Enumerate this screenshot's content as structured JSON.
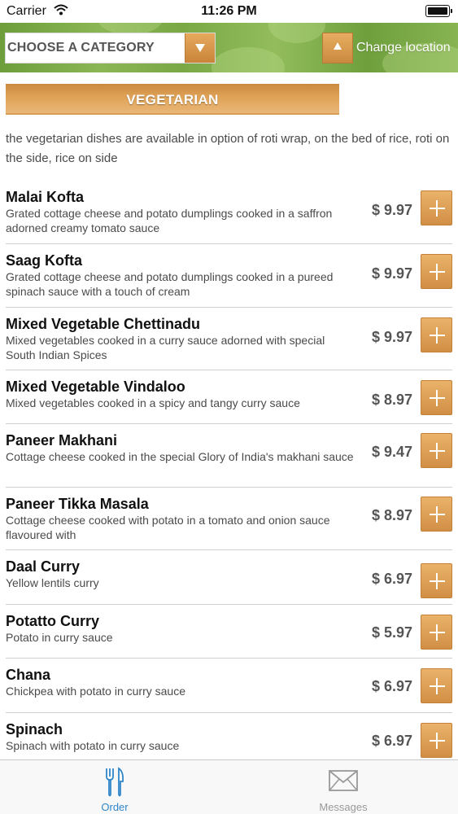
{
  "status_bar": {
    "carrier": "Carrier",
    "time": "11:26 PM"
  },
  "header": {
    "category_placeholder": "CHOOSE A CATEGORY",
    "location_label": "Change location"
  },
  "section": {
    "title": "VEGETARIAN",
    "description": "the vegetarian dishes are available in option of roti wrap, on the bed of rice, roti on the side, rice on side"
  },
  "menu_items": [
    {
      "name": "Malai Kofta",
      "description": "Grated cottage cheese and potato dumplings cooked in a saffron adorned creamy tomato sauce",
      "price": "$ 9.97"
    },
    {
      "name": "Saag Kofta",
      "description": "Grated cottage cheese and potato dumplings cooked in a pureed spinach sauce with a touch of cream",
      "price": "$ 9.97"
    },
    {
      "name": "Mixed Vegetable Chettinadu",
      "description": "Mixed vegetables cooked in a curry sauce adorned with special South Indian Spices",
      "price": "$ 9.97"
    },
    {
      "name": "Mixed Vegetable Vindaloo",
      "description": "Mixed vegetables cooked in a spicy and tangy curry sauce",
      "price": "$ 8.97"
    },
    {
      "name": "Paneer Makhani",
      "description": "Cottage cheese cooked in the special Glory of India's makhani sauce",
      "price": "$ 9.47"
    },
    {
      "name": "Paneer Tikka Masala",
      "description": "Cottage cheese cooked with potato in a tomato and onion sauce flavoured with",
      "price": "$ 8.97"
    },
    {
      "name": "Daal Curry",
      "description": "Yellow lentils curry",
      "price": "$ 6.97"
    },
    {
      "name": "Potatto Curry",
      "description": "Potato in curry sauce",
      "price": "$ 5.97"
    },
    {
      "name": "Chana",
      "description": "Chickpea with potato in curry sauce",
      "price": "$ 6.97"
    },
    {
      "name": "Spinach",
      "description": "Spinach with potato in curry sauce",
      "price": "$ 6.97"
    }
  ],
  "tab_bar": {
    "tabs": [
      {
        "label": "Order",
        "icon": "fork-knife-icon",
        "active": true
      },
      {
        "label": "Messages",
        "icon": "envelope-icon",
        "active": false
      }
    ]
  },
  "colors": {
    "accent_orange": "#dfa257",
    "header_green": "#7aa845",
    "active_tab_blue": "#2f86c9"
  }
}
